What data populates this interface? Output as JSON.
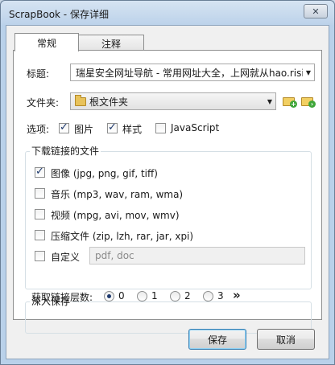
{
  "window": {
    "title": "ScrapBook - 保存详细"
  },
  "icons": {
    "close": "close-icon",
    "folder": "folder-icon",
    "new_folder": "new-folder-icon",
    "move_folder": "move-folder-icon"
  },
  "tabs": [
    {
      "label": "常规"
    },
    {
      "label": "注释"
    }
  ],
  "general": {
    "title_label": "标题:",
    "title_value": "瑞星安全网址导航 - 常用网址大全，上网就从hao.rising",
    "folder_label": "文件夹:",
    "folder_value": "根文件夹",
    "options_label": "选项:",
    "options": [
      {
        "label": "图片",
        "checked": true
      },
      {
        "label": "样式",
        "checked": true
      },
      {
        "label": "JavaScript",
        "checked": false
      }
    ]
  },
  "download": {
    "title": "下载链接的文件",
    "items": [
      {
        "label": "图像 (jpg, png, gif, tiff)",
        "checked": true
      },
      {
        "label": "音乐 (mp3, wav, ram, wma)",
        "checked": false
      },
      {
        "label": "视频 (mpg, avi, mov, wmv)",
        "checked": false
      },
      {
        "label": "压缩文件 (zip, lzh, rar, jar, xpi)",
        "checked": false
      }
    ],
    "custom_label": "自定义",
    "custom_placeholder": "pdf, doc"
  },
  "deep": {
    "title": "深入保存",
    "levels_label": "获取链接层数:",
    "levels": [
      {
        "label": "0",
        "checked": true
      },
      {
        "label": "1",
        "checked": false
      },
      {
        "label": "2",
        "checked": false
      },
      {
        "label": "3",
        "checked": false
      }
    ],
    "more": "»"
  },
  "buttons": {
    "save": "保存",
    "cancel": "取消"
  }
}
